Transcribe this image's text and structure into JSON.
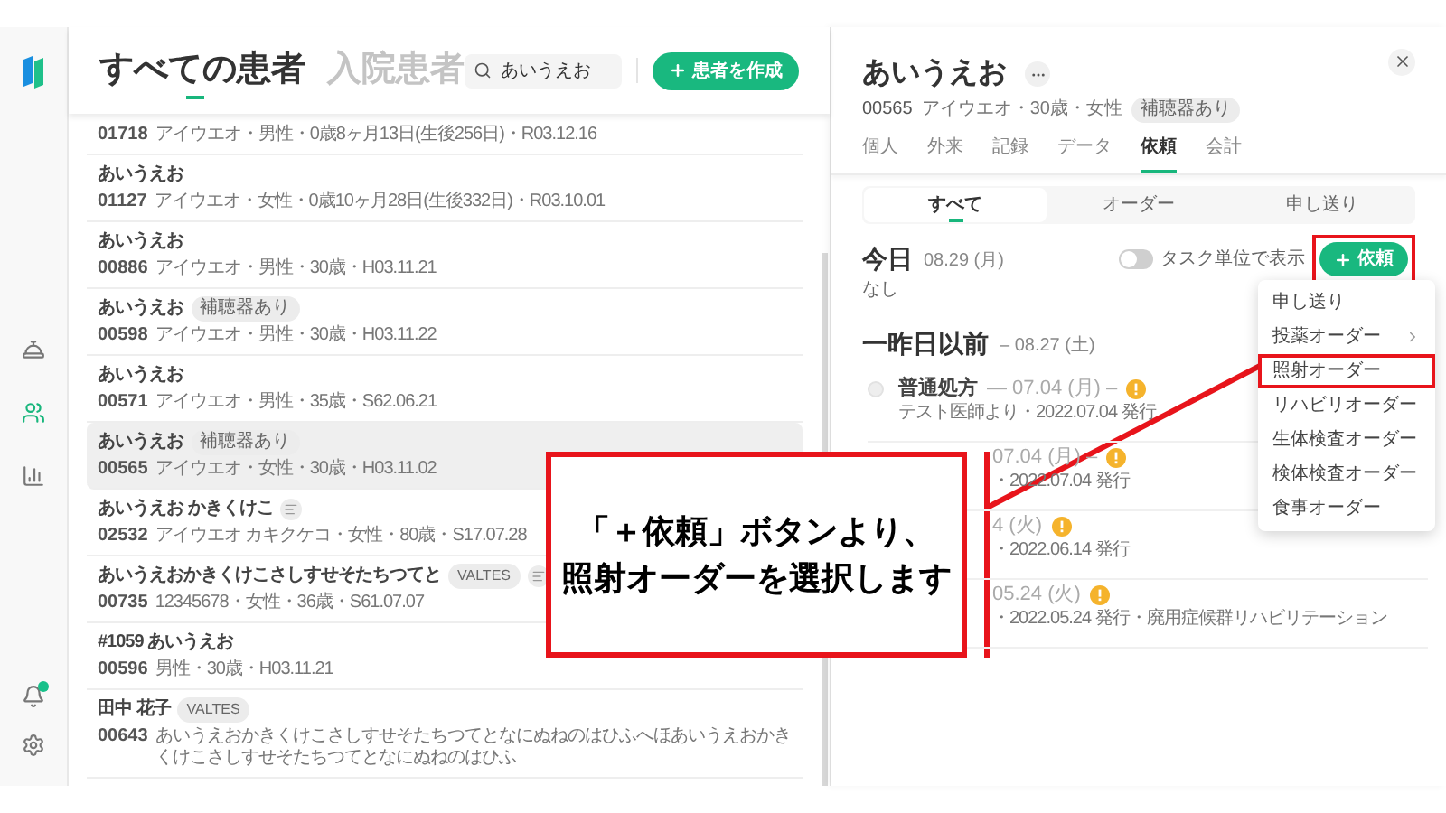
{
  "sidebar": {
    "nav": [
      {
        "selected": false
      },
      {
        "selected": true
      },
      {
        "selected": false
      }
    ],
    "notification_dot": true
  },
  "list_header": {
    "tabs": [
      {
        "label": "すべての患者",
        "selected": true
      },
      {
        "label": "入院患者",
        "selected": false
      }
    ],
    "search": {
      "value": "あいうえお"
    },
    "create_button": "患者を作成"
  },
  "patients": [
    {
      "id": "01718",
      "details": "アイウエオ・男性・0歳8ヶ月13日(生後256日)・R03.12.16",
      "selected": false
    },
    {
      "name": "あいうえお",
      "id": "01127",
      "details": "アイウエオ・女性・0歳10ヶ月28日(生後332日)・R03.10.01",
      "note": false,
      "selected": false
    },
    {
      "name": "あいうえお",
      "id": "00886",
      "details": "アイウエオ・男性・30歳・H03.11.21",
      "note": false,
      "selected": false
    },
    {
      "name": "あいうえお",
      "id": "00598",
      "details": "アイウエオ・男性・30歳・H03.11.22",
      "tags": [
        "補聴器あり"
      ],
      "note": false,
      "selected": false
    },
    {
      "name": "あいうえお",
      "id": "00571",
      "details": "アイウエオ・男性・35歳・S62.06.21",
      "note": false,
      "selected": false
    },
    {
      "name": "あいうえお",
      "id": "00565",
      "details": "アイウエオ・女性・30歳・H03.11.02",
      "tags": [
        "補聴器あり"
      ],
      "note": false,
      "selected": true
    },
    {
      "name": "あいうえお かきくけこ",
      "id": "02532",
      "details": "アイウエオ カキクケコ・女性・80歳・S17.07.28",
      "note": true,
      "selected": false
    },
    {
      "name": "あいうえおかきくけこさしすせそたちつてと",
      "id": "00735",
      "details": "12345678・女性・36歳・S61.07.07",
      "tags": [
        "VALTES"
      ],
      "note": true,
      "selected": false
    },
    {
      "name": "#1059 あいうえお",
      "id": "00596",
      "details": "男性・30歳・H03.11.21",
      "note": false,
      "selected": false
    },
    {
      "name": "田中 花子",
      "id": "00643",
      "details": "あいうえおかきくけこさしすせそたちつてとなにぬねのはひふへほあいうえおかきくけこさしすせそたちつてとなにぬねのはひふ",
      "tags": [
        "VALTES"
      ],
      "note": false,
      "selected": false
    }
  ],
  "detail": {
    "name": "あいうえお",
    "id": "00565",
    "meta": "アイウエオ・30歳・女性",
    "tag": "補聴器あり",
    "tabs": [
      {
        "label": "個人",
        "selected": false
      },
      {
        "label": "外来",
        "selected": false
      },
      {
        "label": "記録",
        "selected": false
      },
      {
        "label": "データ",
        "selected": false
      },
      {
        "label": "依頼",
        "selected": true
      },
      {
        "label": "会計",
        "selected": false
      }
    ],
    "segments": [
      {
        "label": "すべて",
        "selected": true
      },
      {
        "label": "オーダー",
        "selected": false
      },
      {
        "label": "申し送り",
        "selected": false
      }
    ],
    "today": {
      "title": "今日",
      "date": "08.29 (月)",
      "toggle": {
        "label": "タスク単位で表示",
        "on": false
      },
      "request_button": {
        "label": "依頼",
        "highlighted": true
      },
      "empty": "なし"
    },
    "earlier": {
      "title": "一昨日以前",
      "date": "– 08.27 (土)"
    },
    "orders": [
      {
        "title": "普通処方",
        "date": "— 07.04 (月) –",
        "sub": "テスト医師より・2022.07.04 発行",
        "alert": true
      },
      {
        "date": "07.04 (月) –",
        "sub": "・2022.07.04 発行",
        "alert": true
      },
      {
        "date": "4 (火)",
        "sub": "・2022.06.14 発行",
        "alert": true
      },
      {
        "date": "05.24 (火)",
        "sub": "・2022.05.24 発行・廃用症候群リハビリテーション",
        "alert": true
      }
    ],
    "menu": [
      {
        "label": "申し送り",
        "submenu": false,
        "highlighted": false
      },
      {
        "label": "投薬オーダー",
        "submenu": true,
        "highlighted": false
      },
      {
        "label": "照射オーダー",
        "submenu": false,
        "highlighted": true
      },
      {
        "label": "リハビリオーダー",
        "submenu": false,
        "highlighted": false
      },
      {
        "label": "生体検査オーダー",
        "submenu": false,
        "highlighted": false
      },
      {
        "label": "検体検査オーダー",
        "submenu": false,
        "highlighted": false
      },
      {
        "label": "食事オーダー",
        "submenu": false,
        "highlighted": false
      }
    ]
  },
  "annotation": {
    "callout": [
      "「＋依頼」ボタンより、",
      "照射オーダーを選択します"
    ]
  }
}
